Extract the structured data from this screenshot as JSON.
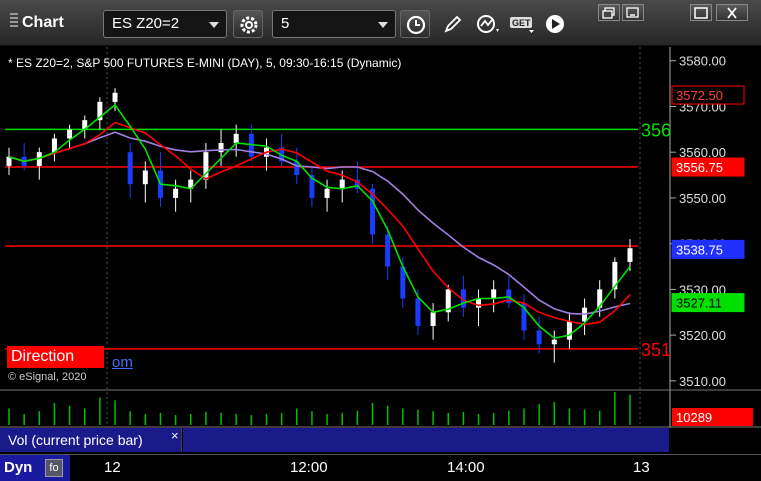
{
  "toolbar": {
    "title": "Chart",
    "symbol": "ES Z20=2",
    "interval": "5",
    "get_icon_text": "GET"
  },
  "legend": "* ES Z20=2, S&P 500 FUTURES E-MINI (DAY), 5, 09:30-16:15 (Dynamic)",
  "copyright": "© eSignal, 2020",
  "direction_label": "Direction",
  "link_fragment": "om",
  "vol_label": "Vol (current price bar)",
  "vol_close": "×",
  "dyn_label": "Dyn",
  "dyn_icon_text": "fo",
  "colors": {
    "up_bar": "#ffffff",
    "down_bar": "#1a3cff",
    "fast_ma": "#00e000",
    "slow_ma": "#ff0000",
    "long_ma": "#a080e0",
    "level_green": "#00e000",
    "level_red": "#ff0000",
    "volume": "#00c000"
  },
  "chart_data": {
    "type": "candlestick",
    "title": "* ES Z20=2, S&P 500 FUTURES E-MINI (DAY), 5, 09:30-16:15 (Dynamic)",
    "ylim": [
      3508,
      3583
    ],
    "y_ticks": [
      "3580.00",
      "3570.00",
      "3560.00",
      "3550.00",
      "3540.00",
      "3530.00",
      "3520.00",
      "3510.00"
    ],
    "x_ticks": [
      "12",
      "12:00",
      "14:00",
      "13"
    ],
    "price_labels": [
      {
        "text": "3572.50",
        "value": 3572.5,
        "bg": "#000000",
        "fg": "#ff4040",
        "border": "#ff0000"
      },
      {
        "text": "3556.75",
        "value": 3556.75,
        "bg": "#ff0000",
        "fg": "#ffffff"
      },
      {
        "text": "3538.75",
        "value": 3538.75,
        "bg": "#2030ff",
        "fg": "#ffffff"
      },
      {
        "text": "3527.11",
        "value": 3527.11,
        "bg": "#00e000",
        "fg": "#000000"
      }
    ],
    "level_lines": [
      {
        "value": 3565.0,
        "color": "#00e000",
        "label": "356"
      },
      {
        "value": 3556.75,
        "color": "#ff0000",
        "label": ""
      },
      {
        "value": 3539.5,
        "color": "#ff0000",
        "label": ""
      },
      {
        "value": 3517.0,
        "color": "#ff0000",
        "label": "351"
      }
    ],
    "candles_ohlc": [
      [
        3557,
        3561,
        3555,
        3559
      ],
      [
        3559,
        3562,
        3556,
        3557
      ],
      [
        3557,
        3561,
        3554,
        3560
      ],
      [
        3560,
        3564,
        3558,
        3563
      ],
      [
        3563,
        3566,
        3561,
        3565
      ],
      [
        3565,
        3568,
        3563,
        3567
      ],
      [
        3567,
        3572,
        3565,
        3571
      ],
      [
        3571,
        3574,
        3569,
        3573
      ],
      [
        3560,
        3562,
        3550,
        3553
      ],
      [
        3553,
        3558,
        3549,
        3556
      ],
      [
        3556,
        3560,
        3548,
        3550
      ],
      [
        3550,
        3554,
        3547,
        3552
      ],
      [
        3552,
        3556,
        3549,
        3554
      ],
      [
        3554,
        3562,
        3552,
        3560
      ],
      [
        3560,
        3565,
        3557,
        3562
      ],
      [
        3562,
        3566,
        3559,
        3564
      ],
      [
        3564,
        3566,
        3558,
        3559
      ],
      [
        3559,
        3563,
        3556,
        3561
      ],
      [
        3561,
        3564,
        3557,
        3558
      ],
      [
        3558,
        3561,
        3553,
        3555
      ],
      [
        3555,
        3557,
        3548,
        3550
      ],
      [
        3550,
        3554,
        3547,
        3552
      ],
      [
        3552,
        3556,
        3549,
        3554
      ],
      [
        3554,
        3558,
        3551,
        3552
      ],
      [
        3552,
        3553,
        3540,
        3542
      ],
      [
        3542,
        3544,
        3532,
        3535
      ],
      [
        3535,
        3537,
        3526,
        3528
      ],
      [
        3528,
        3530,
        3520,
        3522
      ],
      [
        3522,
        3527,
        3519,
        3525
      ],
      [
        3525,
        3531,
        3523,
        3530
      ],
      [
        3530,
        3533,
        3524,
        3526
      ],
      [
        3526,
        3530,
        3522,
        3528
      ],
      [
        3528,
        3532,
        3525,
        3530
      ],
      [
        3530,
        3533,
        3526,
        3527
      ],
      [
        3527,
        3529,
        3519,
        3521
      ],
      [
        3521,
        3524,
        3516,
        3518
      ],
      [
        3518,
        3521,
        3514,
        3519
      ],
      [
        3519,
        3525,
        3517,
        3523
      ],
      [
        3523,
        3528,
        3520,
        3526
      ],
      [
        3526,
        3532,
        3524,
        3530
      ],
      [
        3530,
        3537,
        3528,
        3536
      ],
      [
        3536,
        3541,
        3534,
        3539
      ]
    ],
    "volume_max_label": "10289",
    "volume": [
      30,
      20,
      25,
      40,
      35,
      30,
      50,
      45,
      25,
      20,
      22,
      18,
      20,
      24,
      22,
      20,
      18,
      20,
      22,
      30,
      25,
      20,
      22,
      26,
      40,
      35,
      30,
      28,
      25,
      22,
      24,
      20,
      22,
      26,
      30,
      38,
      42,
      30,
      28,
      26,
      60,
      55
    ]
  }
}
